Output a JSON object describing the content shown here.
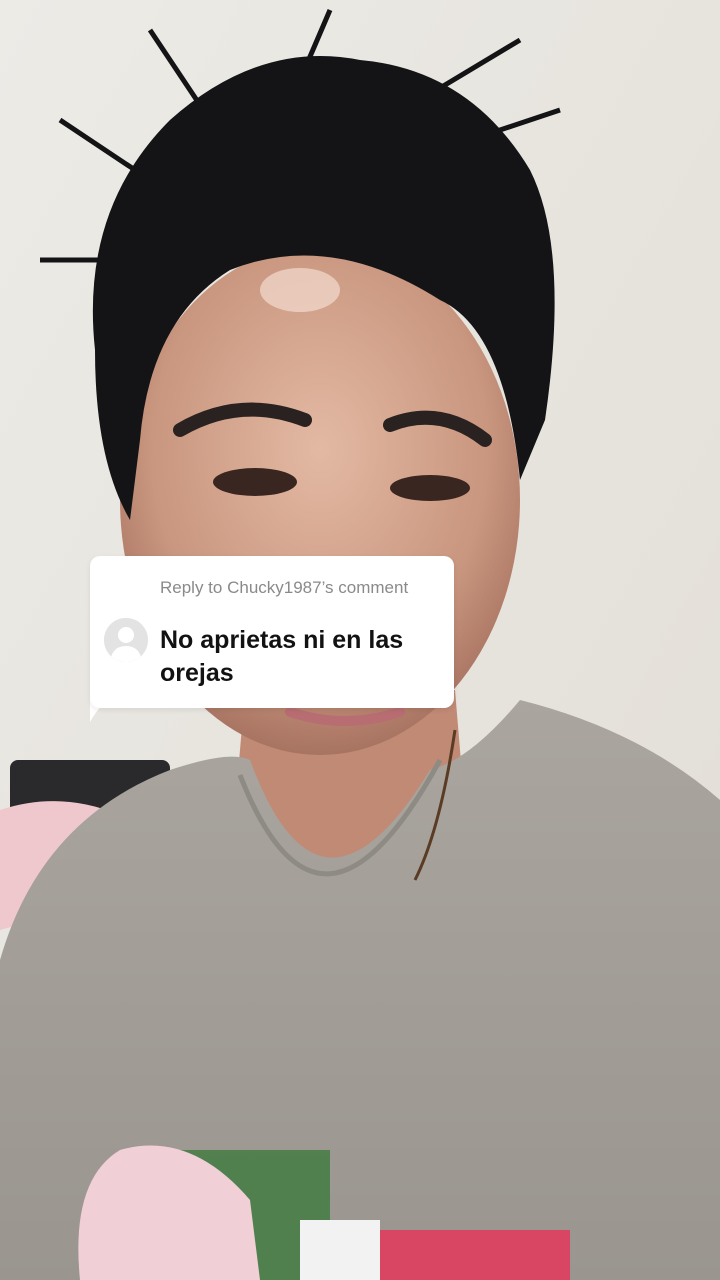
{
  "video": {
    "description_icon": "person-selfie-video-frame"
  },
  "reply_sticker": {
    "header": "Reply to Chucky1987’s comment",
    "comment_text": "No aprietas ni en las orejas",
    "avatar_icon": "default-avatar-icon"
  }
}
